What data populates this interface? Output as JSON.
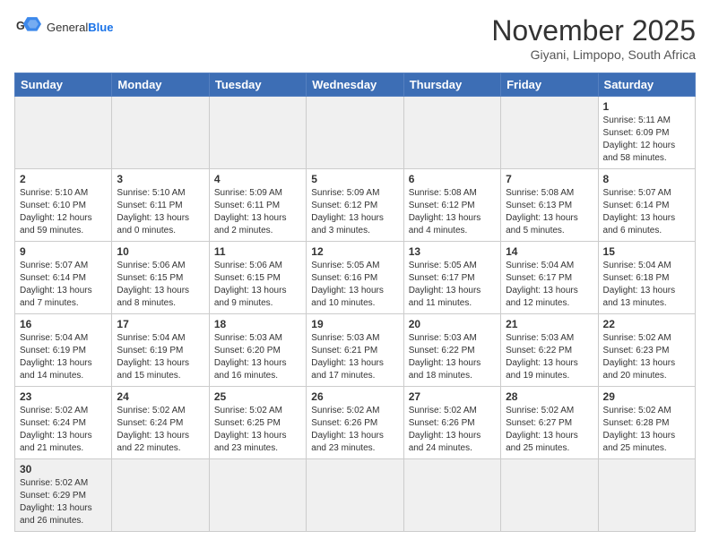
{
  "header": {
    "logo_general": "General",
    "logo_blue": "Blue",
    "title": "November 2025",
    "subtitle": "Giyani, Limpopo, South Africa"
  },
  "weekdays": [
    "Sunday",
    "Monday",
    "Tuesday",
    "Wednesday",
    "Thursday",
    "Friday",
    "Saturday"
  ],
  "weeks": [
    [
      {
        "num": "",
        "info": ""
      },
      {
        "num": "",
        "info": ""
      },
      {
        "num": "",
        "info": ""
      },
      {
        "num": "",
        "info": ""
      },
      {
        "num": "",
        "info": ""
      },
      {
        "num": "",
        "info": ""
      },
      {
        "num": "1",
        "info": "Sunrise: 5:11 AM\nSunset: 6:09 PM\nDaylight: 12 hours\nand 58 minutes."
      }
    ],
    [
      {
        "num": "2",
        "info": "Sunrise: 5:10 AM\nSunset: 6:10 PM\nDaylight: 12 hours\nand 59 minutes."
      },
      {
        "num": "3",
        "info": "Sunrise: 5:10 AM\nSunset: 6:11 PM\nDaylight: 13 hours\nand 0 minutes."
      },
      {
        "num": "4",
        "info": "Sunrise: 5:09 AM\nSunset: 6:11 PM\nDaylight: 13 hours\nand 2 minutes."
      },
      {
        "num": "5",
        "info": "Sunrise: 5:09 AM\nSunset: 6:12 PM\nDaylight: 13 hours\nand 3 minutes."
      },
      {
        "num": "6",
        "info": "Sunrise: 5:08 AM\nSunset: 6:12 PM\nDaylight: 13 hours\nand 4 minutes."
      },
      {
        "num": "7",
        "info": "Sunrise: 5:08 AM\nSunset: 6:13 PM\nDaylight: 13 hours\nand 5 minutes."
      },
      {
        "num": "8",
        "info": "Sunrise: 5:07 AM\nSunset: 6:14 PM\nDaylight: 13 hours\nand 6 minutes."
      }
    ],
    [
      {
        "num": "9",
        "info": "Sunrise: 5:07 AM\nSunset: 6:14 PM\nDaylight: 13 hours\nand 7 minutes."
      },
      {
        "num": "10",
        "info": "Sunrise: 5:06 AM\nSunset: 6:15 PM\nDaylight: 13 hours\nand 8 minutes."
      },
      {
        "num": "11",
        "info": "Sunrise: 5:06 AM\nSunset: 6:15 PM\nDaylight: 13 hours\nand 9 minutes."
      },
      {
        "num": "12",
        "info": "Sunrise: 5:05 AM\nSunset: 6:16 PM\nDaylight: 13 hours\nand 10 minutes."
      },
      {
        "num": "13",
        "info": "Sunrise: 5:05 AM\nSunset: 6:17 PM\nDaylight: 13 hours\nand 11 minutes."
      },
      {
        "num": "14",
        "info": "Sunrise: 5:04 AM\nSunset: 6:17 PM\nDaylight: 13 hours\nand 12 minutes."
      },
      {
        "num": "15",
        "info": "Sunrise: 5:04 AM\nSunset: 6:18 PM\nDaylight: 13 hours\nand 13 minutes."
      }
    ],
    [
      {
        "num": "16",
        "info": "Sunrise: 5:04 AM\nSunset: 6:19 PM\nDaylight: 13 hours\nand 14 minutes."
      },
      {
        "num": "17",
        "info": "Sunrise: 5:04 AM\nSunset: 6:19 PM\nDaylight: 13 hours\nand 15 minutes."
      },
      {
        "num": "18",
        "info": "Sunrise: 5:03 AM\nSunset: 6:20 PM\nDaylight: 13 hours\nand 16 minutes."
      },
      {
        "num": "19",
        "info": "Sunrise: 5:03 AM\nSunset: 6:21 PM\nDaylight: 13 hours\nand 17 minutes."
      },
      {
        "num": "20",
        "info": "Sunrise: 5:03 AM\nSunset: 6:22 PM\nDaylight: 13 hours\nand 18 minutes."
      },
      {
        "num": "21",
        "info": "Sunrise: 5:03 AM\nSunset: 6:22 PM\nDaylight: 13 hours\nand 19 minutes."
      },
      {
        "num": "22",
        "info": "Sunrise: 5:02 AM\nSunset: 6:23 PM\nDaylight: 13 hours\nand 20 minutes."
      }
    ],
    [
      {
        "num": "23",
        "info": "Sunrise: 5:02 AM\nSunset: 6:24 PM\nDaylight: 13 hours\nand 21 minutes."
      },
      {
        "num": "24",
        "info": "Sunrise: 5:02 AM\nSunset: 6:24 PM\nDaylight: 13 hours\nand 22 minutes."
      },
      {
        "num": "25",
        "info": "Sunrise: 5:02 AM\nSunset: 6:25 PM\nDaylight: 13 hours\nand 23 minutes."
      },
      {
        "num": "26",
        "info": "Sunrise: 5:02 AM\nSunset: 6:26 PM\nDaylight: 13 hours\nand 23 minutes."
      },
      {
        "num": "27",
        "info": "Sunrise: 5:02 AM\nSunset: 6:26 PM\nDaylight: 13 hours\nand 24 minutes."
      },
      {
        "num": "28",
        "info": "Sunrise: 5:02 AM\nSunset: 6:27 PM\nDaylight: 13 hours\nand 25 minutes."
      },
      {
        "num": "29",
        "info": "Sunrise: 5:02 AM\nSunset: 6:28 PM\nDaylight: 13 hours\nand 25 minutes."
      }
    ],
    [
      {
        "num": "30",
        "info": "Sunrise: 5:02 AM\nSunset: 6:29 PM\nDaylight: 13 hours\nand 26 minutes."
      },
      {
        "num": "",
        "info": ""
      },
      {
        "num": "",
        "info": ""
      },
      {
        "num": "",
        "info": ""
      },
      {
        "num": "",
        "info": ""
      },
      {
        "num": "",
        "info": ""
      },
      {
        "num": "",
        "info": ""
      }
    ]
  ]
}
